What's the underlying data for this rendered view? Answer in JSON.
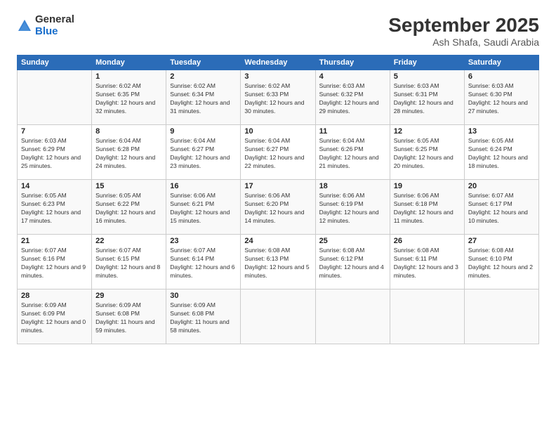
{
  "logo": {
    "general": "General",
    "blue": "Blue"
  },
  "title": "September 2025",
  "location": "Ash Shafa, Saudi Arabia",
  "header_days": [
    "Sunday",
    "Monday",
    "Tuesday",
    "Wednesday",
    "Thursday",
    "Friday",
    "Saturday"
  ],
  "weeks": [
    [
      {
        "num": "",
        "sunrise": "",
        "sunset": "",
        "daylight": ""
      },
      {
        "num": "1",
        "sunrise": "Sunrise: 6:02 AM",
        "sunset": "Sunset: 6:35 PM",
        "daylight": "Daylight: 12 hours and 32 minutes."
      },
      {
        "num": "2",
        "sunrise": "Sunrise: 6:02 AM",
        "sunset": "Sunset: 6:34 PM",
        "daylight": "Daylight: 12 hours and 31 minutes."
      },
      {
        "num": "3",
        "sunrise": "Sunrise: 6:02 AM",
        "sunset": "Sunset: 6:33 PM",
        "daylight": "Daylight: 12 hours and 30 minutes."
      },
      {
        "num": "4",
        "sunrise": "Sunrise: 6:03 AM",
        "sunset": "Sunset: 6:32 PM",
        "daylight": "Daylight: 12 hours and 29 minutes."
      },
      {
        "num": "5",
        "sunrise": "Sunrise: 6:03 AM",
        "sunset": "Sunset: 6:31 PM",
        "daylight": "Daylight: 12 hours and 28 minutes."
      },
      {
        "num": "6",
        "sunrise": "Sunrise: 6:03 AM",
        "sunset": "Sunset: 6:30 PM",
        "daylight": "Daylight: 12 hours and 27 minutes."
      }
    ],
    [
      {
        "num": "7",
        "sunrise": "Sunrise: 6:03 AM",
        "sunset": "Sunset: 6:29 PM",
        "daylight": "Daylight: 12 hours and 25 minutes."
      },
      {
        "num": "8",
        "sunrise": "Sunrise: 6:04 AM",
        "sunset": "Sunset: 6:28 PM",
        "daylight": "Daylight: 12 hours and 24 minutes."
      },
      {
        "num": "9",
        "sunrise": "Sunrise: 6:04 AM",
        "sunset": "Sunset: 6:27 PM",
        "daylight": "Daylight: 12 hours and 23 minutes."
      },
      {
        "num": "10",
        "sunrise": "Sunrise: 6:04 AM",
        "sunset": "Sunset: 6:27 PM",
        "daylight": "Daylight: 12 hours and 22 minutes."
      },
      {
        "num": "11",
        "sunrise": "Sunrise: 6:04 AM",
        "sunset": "Sunset: 6:26 PM",
        "daylight": "Daylight: 12 hours and 21 minutes."
      },
      {
        "num": "12",
        "sunrise": "Sunrise: 6:05 AM",
        "sunset": "Sunset: 6:25 PM",
        "daylight": "Daylight: 12 hours and 20 minutes."
      },
      {
        "num": "13",
        "sunrise": "Sunrise: 6:05 AM",
        "sunset": "Sunset: 6:24 PM",
        "daylight": "Daylight: 12 hours and 18 minutes."
      }
    ],
    [
      {
        "num": "14",
        "sunrise": "Sunrise: 6:05 AM",
        "sunset": "Sunset: 6:23 PM",
        "daylight": "Daylight: 12 hours and 17 minutes."
      },
      {
        "num": "15",
        "sunrise": "Sunrise: 6:05 AM",
        "sunset": "Sunset: 6:22 PM",
        "daylight": "Daylight: 12 hours and 16 minutes."
      },
      {
        "num": "16",
        "sunrise": "Sunrise: 6:06 AM",
        "sunset": "Sunset: 6:21 PM",
        "daylight": "Daylight: 12 hours and 15 minutes."
      },
      {
        "num": "17",
        "sunrise": "Sunrise: 6:06 AM",
        "sunset": "Sunset: 6:20 PM",
        "daylight": "Daylight: 12 hours and 14 minutes."
      },
      {
        "num": "18",
        "sunrise": "Sunrise: 6:06 AM",
        "sunset": "Sunset: 6:19 PM",
        "daylight": "Daylight: 12 hours and 12 minutes."
      },
      {
        "num": "19",
        "sunrise": "Sunrise: 6:06 AM",
        "sunset": "Sunset: 6:18 PM",
        "daylight": "Daylight: 12 hours and 11 minutes."
      },
      {
        "num": "20",
        "sunrise": "Sunrise: 6:07 AM",
        "sunset": "Sunset: 6:17 PM",
        "daylight": "Daylight: 12 hours and 10 minutes."
      }
    ],
    [
      {
        "num": "21",
        "sunrise": "Sunrise: 6:07 AM",
        "sunset": "Sunset: 6:16 PM",
        "daylight": "Daylight: 12 hours and 9 minutes."
      },
      {
        "num": "22",
        "sunrise": "Sunrise: 6:07 AM",
        "sunset": "Sunset: 6:15 PM",
        "daylight": "Daylight: 12 hours and 8 minutes."
      },
      {
        "num": "23",
        "sunrise": "Sunrise: 6:07 AM",
        "sunset": "Sunset: 6:14 PM",
        "daylight": "Daylight: 12 hours and 6 minutes."
      },
      {
        "num": "24",
        "sunrise": "Sunrise: 6:08 AM",
        "sunset": "Sunset: 6:13 PM",
        "daylight": "Daylight: 12 hours and 5 minutes."
      },
      {
        "num": "25",
        "sunrise": "Sunrise: 6:08 AM",
        "sunset": "Sunset: 6:12 PM",
        "daylight": "Daylight: 12 hours and 4 minutes."
      },
      {
        "num": "26",
        "sunrise": "Sunrise: 6:08 AM",
        "sunset": "Sunset: 6:11 PM",
        "daylight": "Daylight: 12 hours and 3 minutes."
      },
      {
        "num": "27",
        "sunrise": "Sunrise: 6:08 AM",
        "sunset": "Sunset: 6:10 PM",
        "daylight": "Daylight: 12 hours and 2 minutes."
      }
    ],
    [
      {
        "num": "28",
        "sunrise": "Sunrise: 6:09 AM",
        "sunset": "Sunset: 6:09 PM",
        "daylight": "Daylight: 12 hours and 0 minutes."
      },
      {
        "num": "29",
        "sunrise": "Sunrise: 6:09 AM",
        "sunset": "Sunset: 6:08 PM",
        "daylight": "Daylight: 11 hours and 59 minutes."
      },
      {
        "num": "30",
        "sunrise": "Sunrise: 6:09 AM",
        "sunset": "Sunset: 6:08 PM",
        "daylight": "Daylight: 11 hours and 58 minutes."
      },
      {
        "num": "",
        "sunrise": "",
        "sunset": "",
        "daylight": ""
      },
      {
        "num": "",
        "sunrise": "",
        "sunset": "",
        "daylight": ""
      },
      {
        "num": "",
        "sunrise": "",
        "sunset": "",
        "daylight": ""
      },
      {
        "num": "",
        "sunrise": "",
        "sunset": "",
        "daylight": ""
      }
    ]
  ]
}
